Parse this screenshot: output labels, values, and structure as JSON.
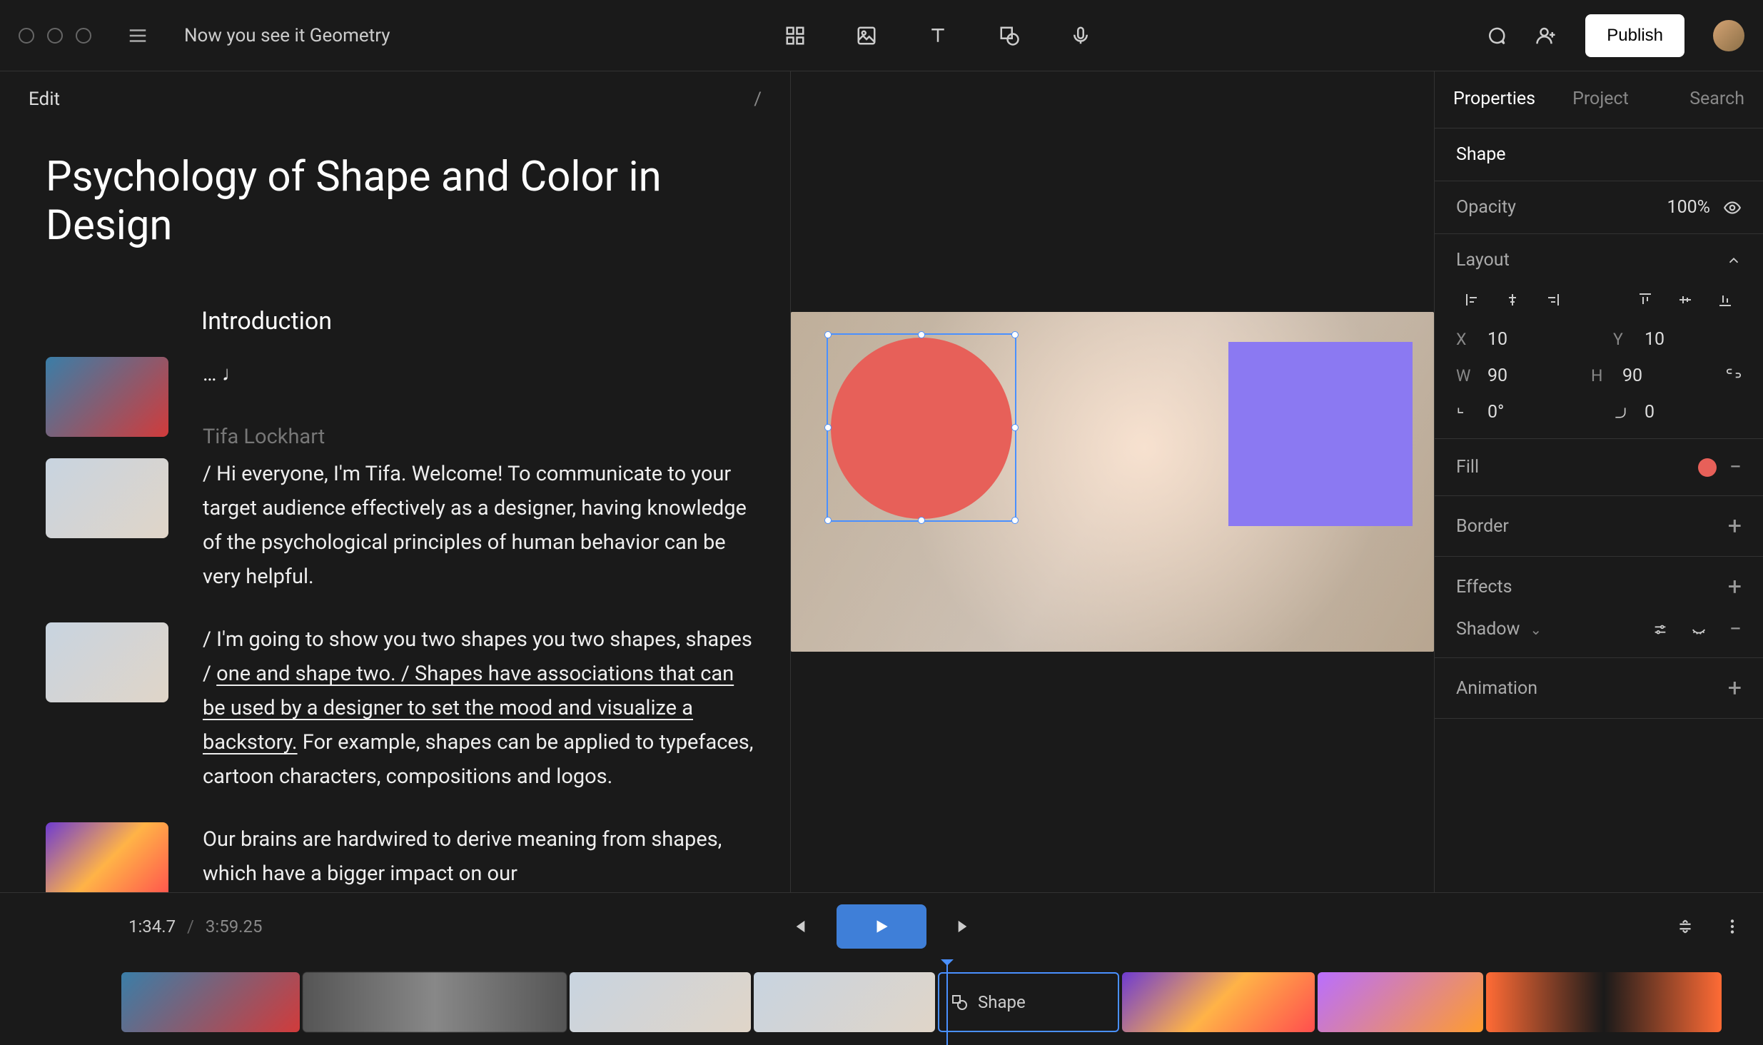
{
  "header": {
    "doc_title": "Now you see it Geometry",
    "publish_label": "Publish"
  },
  "script": {
    "edit_label": "Edit",
    "slash": "/",
    "page_title": "Psychology of Shape and Color in Design",
    "section_heading": "Introduction",
    "dots_line": "… ♩",
    "speaker": "Tifa Lockhart",
    "para1": "/ Hi everyone, I'm Tifa. Welcome! To communicate to your target audience effectively as a designer, having knowledge of the psychological principles of human behavior can be very helpful.",
    "para2_pre": "/ I'm going to show you two shapes you two shapes, shapes / ",
    "para2_link": "one and shape two. / Shapes have associations that can be used by a designer to set the mood and visualize a backstory.",
    "para2_post": " For example, shapes can be applied to typefaces, cartoon characters, compositions and logos.",
    "para3": "Our brains are hardwired to derive meaning from shapes, which have a bigger impact on our"
  },
  "props": {
    "tabs": {
      "properties": "Properties",
      "project": "Project",
      "search": "Search"
    },
    "shape_label": "Shape",
    "opacity_label": "Opacity",
    "opacity_value": "100%",
    "layout_label": "Layout",
    "x_label": "X",
    "x_val": "10",
    "y_label": "Y",
    "y_val": "10",
    "w_label": "W",
    "w_val": "90",
    "h_label": "H",
    "h_val": "90",
    "rot_label": "⌐",
    "rot_val": "0°",
    "rad_label": "⌐",
    "rad_val": "0",
    "fill_label": "Fill",
    "fill_color": "#e76059",
    "border_label": "Border",
    "effects_label": "Effects",
    "shadow_label": "Shadow",
    "animation_label": "Animation"
  },
  "playback": {
    "current": "1:34.7",
    "sep": "/",
    "duration": "3:59.25"
  },
  "timeline": {
    "shape_clip_label": "Shape"
  }
}
